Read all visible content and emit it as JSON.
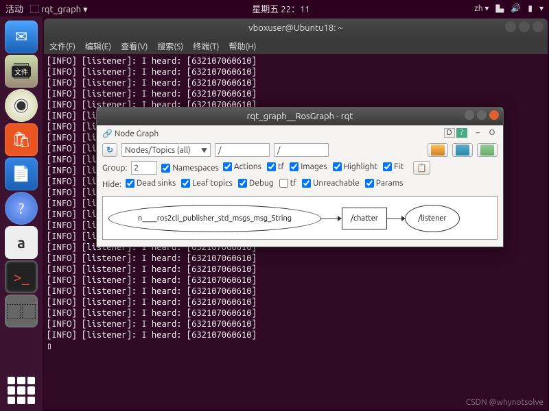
{
  "topbar": {
    "activities": "活动",
    "app": "rqt_graph",
    "clock": "星期五  22：11",
    "lang": "zh ▾"
  },
  "dock": {
    "files_badge": "文件"
  },
  "terminal": {
    "title": "vboxuser@Ubuntu18: ~",
    "menus": [
      "文件(F)",
      "编辑(E)",
      "查看(V)",
      "搜索(S)",
      "终端(T)",
      "帮助(H)"
    ],
    "log_line": "[INFO] [listener]: I heard: [632107060610]",
    "log_count": 26,
    "cursor": "▯"
  },
  "rqt": {
    "title": "rqt_graph__RosGraph - rqt",
    "panel_label": "Node Graph",
    "panel_buttons": {
      "d": "D",
      "q": "?",
      "min": "–",
      "o": "O"
    },
    "refresh_icon": "↻",
    "combo_value": "Nodes/Topics (all)",
    "path1": "/",
    "path2": "/",
    "group_label": "Group:",
    "group_value": "2",
    "namespaces_label": "Namespaces",
    "checks_row1": [
      {
        "k": "actions",
        "label": "Actions",
        "v": true
      },
      {
        "k": "tf1",
        "label": "tf",
        "v": true
      },
      {
        "k": "images",
        "label": "Images",
        "v": true
      },
      {
        "k": "highlight",
        "label": "Highlight",
        "v": true
      },
      {
        "k": "fit",
        "label": "Fit",
        "v": true
      }
    ],
    "hide_label": "Hide:",
    "checks_row2": [
      {
        "k": "dead",
        "label": "Dead sinks",
        "v": true
      },
      {
        "k": "leaf",
        "label": "Leaf topics",
        "v": true
      },
      {
        "k": "debug",
        "label": "Debug",
        "v": true
      },
      {
        "k": "tf2",
        "label": "tf",
        "v": false
      },
      {
        "k": "unreach",
        "label": "Unreachable",
        "v": true
      },
      {
        "k": "params",
        "label": "Params",
        "v": true
      }
    ],
    "graph": {
      "node1": "n____ros2cli_publisher_std_msgs_msg_String",
      "topic": "/chatter",
      "node2": "/listener"
    }
  },
  "watermark": "CSDN @whynotsolve"
}
